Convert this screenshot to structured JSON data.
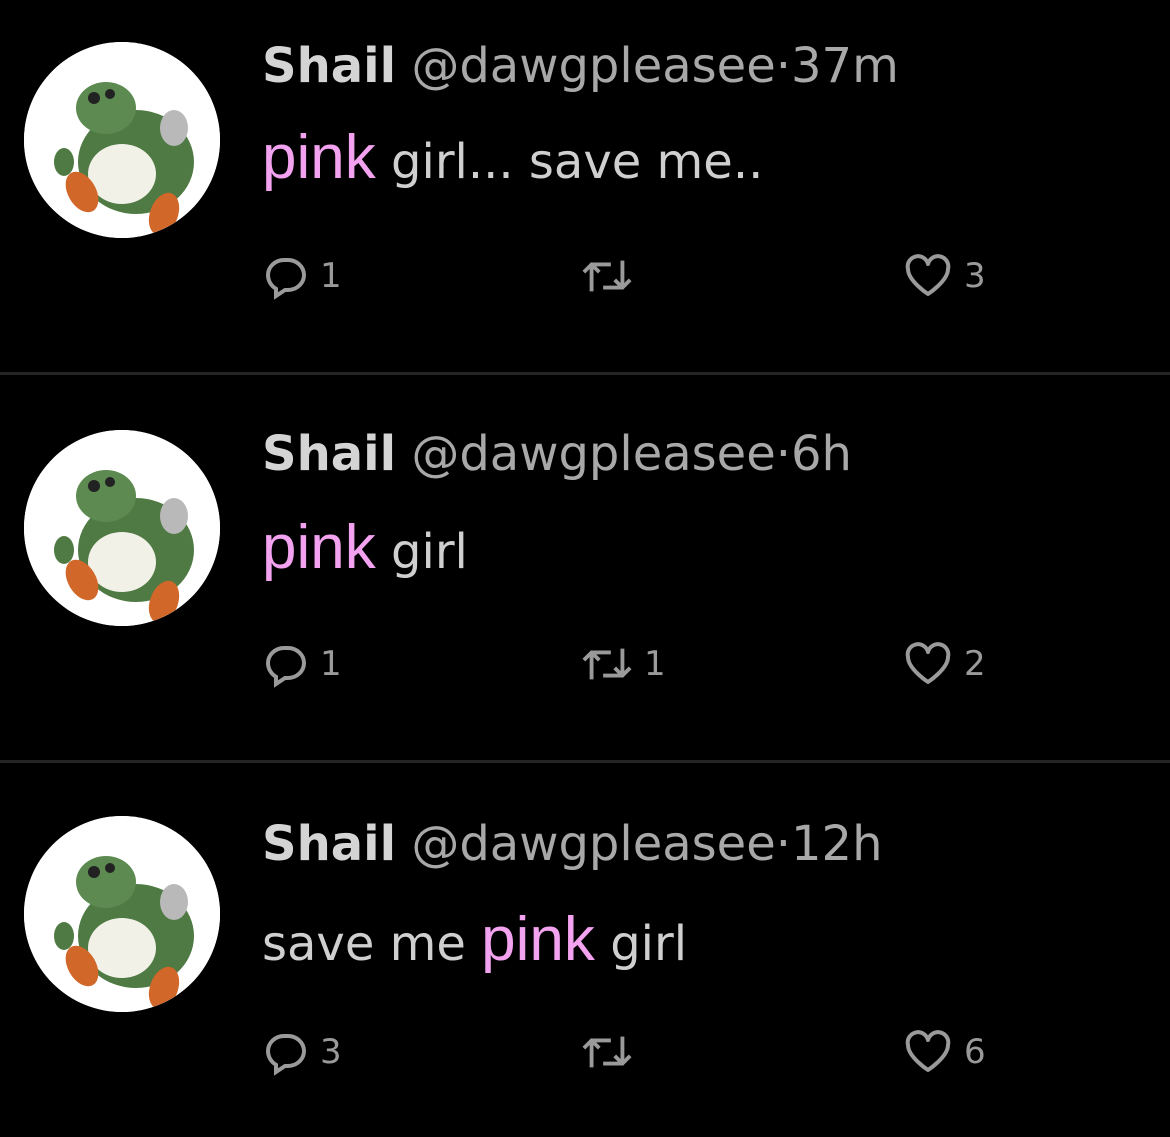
{
  "tweets": [
    {
      "name": "Shail",
      "handle": "@dawgpleasee",
      "separator": "·",
      "time": "37m",
      "text_before": "",
      "pink": "pink",
      "text_after": "girl... save me..",
      "replies": "1",
      "retweets": "",
      "likes": "3"
    },
    {
      "name": "Shail",
      "handle": "@dawgpleasee",
      "separator": "·",
      "time": "6h",
      "text_before": "",
      "pink": "pink",
      "text_after": "girl",
      "replies": "1",
      "retweets": "1",
      "likes": "2"
    },
    {
      "name": "Shail",
      "handle": "@dawgpleasee",
      "separator": "·",
      "time": "12h",
      "text_before": "save me",
      "pink": "pink",
      "text_after": "girl",
      "replies": "3",
      "retweets": "",
      "likes": "6"
    }
  ],
  "icons": {
    "reply": "reply-bubble-icon",
    "retweet": "retweet-icon",
    "like": "heart-icon"
  },
  "colors": {
    "background": "#000000",
    "pink_text": "#f3a2f0",
    "divider": "#242424",
    "muted": "#a8a8a8"
  }
}
